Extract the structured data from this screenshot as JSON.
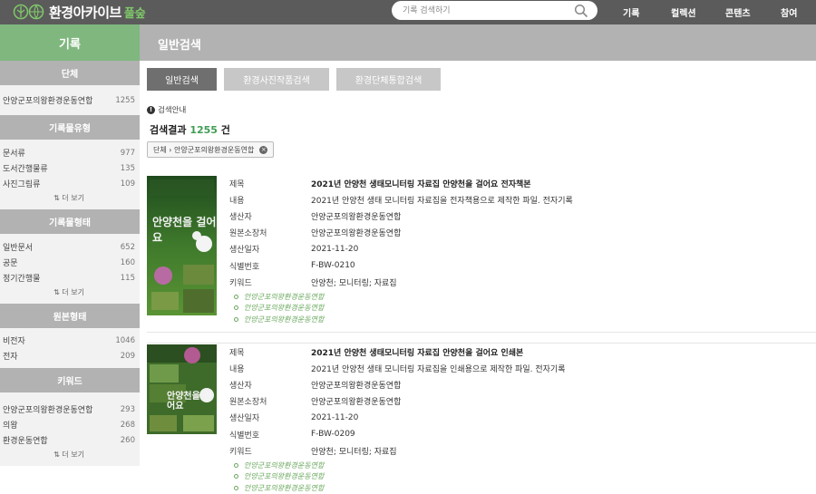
{
  "header": {
    "logo_text": "환경아카이브",
    "logo_sub": "풀숲",
    "search_placeholder": "기록 검색하기",
    "nav": [
      "기록",
      "컬렉션",
      "콘텐츠",
      "참여"
    ]
  },
  "sidebar": {
    "title": "기록",
    "facets": [
      {
        "head": "단체",
        "items": [
          {
            "label": "안양군포의왕환경운동연합",
            "count": "1255"
          }
        ],
        "more": ""
      },
      {
        "head": "기록물유형",
        "items": [
          {
            "label": "문서류",
            "count": "977"
          },
          {
            "label": "도서간행물류",
            "count": "135"
          },
          {
            "label": "사진그림류",
            "count": "109"
          }
        ],
        "more": "⇅ 더 보기"
      },
      {
        "head": "기록물형태",
        "items": [
          {
            "label": "일반문서",
            "count": "652"
          },
          {
            "label": "공문",
            "count": "160"
          },
          {
            "label": "정기간행물",
            "count": "115"
          }
        ],
        "more": "⇅ 더 보기"
      },
      {
        "head": "원본형태",
        "items": [
          {
            "label": "비전자",
            "count": "1046"
          },
          {
            "label": "전자",
            "count": "209"
          }
        ],
        "more": ""
      },
      {
        "head": "키워드",
        "items": [
          {
            "label": "안양군포의왕환경운동연합",
            "count": "293"
          },
          {
            "label": "의왕",
            "count": "268"
          },
          {
            "label": "환경운동연합",
            "count": "260"
          }
        ],
        "more": "⇅ 더 보기"
      }
    ]
  },
  "main": {
    "title": "일반검색",
    "tabs": [
      "일반검색",
      "환경사진작품검색",
      "환경단체통합검색"
    ],
    "guide": "검색안내",
    "result_prefix": "검색결과",
    "result_count": "1255",
    "result_suffix": "건",
    "filter_chip": "단체 › 안양군포의왕환경운동연합",
    "field_labels": [
      "제목",
      "내용",
      "생산자",
      "원본소장처",
      "생산일자",
      "식별번호",
      "키워드"
    ],
    "records": [
      {
        "values": [
          "2021년 안양천 생태모니터링 자료집 안양천을 걸어요 전자책본",
          "2021년 안양천 생태 모니터링 자료집을 전자책용으로 제작한 파일. 전자기록",
          "안양군포의왕환경운동연합",
          "안양군포의왕환경운동연합",
          "2021-11-20",
          "F-BW-0210",
          "안양천; 모니터링; 자료집"
        ],
        "links": [
          "안양군포의왕환경운동연합",
          "안양군포의왕환경운동연합",
          "안양군포의왕환경운동연합"
        ],
        "cover_title": "안양천을 걸어요"
      },
      {
        "values": [
          "2021년 안양천 생태모니터링 자료집 안양천을 걸어요 인쇄본",
          "2021년 안양천 생태 모니터링 자료집을 인쇄용으로 제작한 파일. 전자기록",
          "안양군포의왕환경운동연합",
          "안양군포의왕환경운동연합",
          "2021-11-20",
          "F-BW-0209",
          "안양천; 모니터링; 자료집"
        ],
        "links": [
          "안양군포의왕환경운동연합",
          "안양군포의왕환경운동연합",
          "안양군포의왕환경운동연합"
        ],
        "cover_title": "안양천을 걸어요"
      }
    ]
  },
  "colors": {
    "accent": "#7fb77e",
    "topbar": "#5b5b5b",
    "gray_head": "#b2b2b2",
    "count_green": "#3f9d55"
  }
}
